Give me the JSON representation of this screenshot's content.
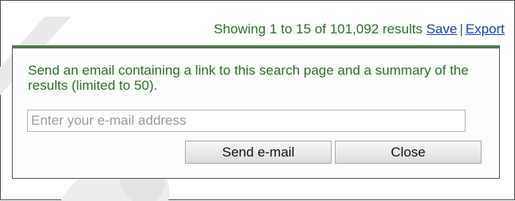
{
  "results": {
    "summary": "Showing 1 to 15 of 101,092 results",
    "save_label": "Save",
    "separator": "|",
    "export_label": "Export"
  },
  "email_panel": {
    "message": "Send an email containing a link to this search page and a summary of the results (limited to 50).",
    "email_placeholder": "Enter your e-mail address",
    "email_value": "",
    "send_label": "Send e-mail",
    "close_label": "Close"
  },
  "colors": {
    "text_green": "#2f6d2a",
    "link_blue": "#1a3fb0",
    "panel_top_border": "#4f7a48"
  }
}
